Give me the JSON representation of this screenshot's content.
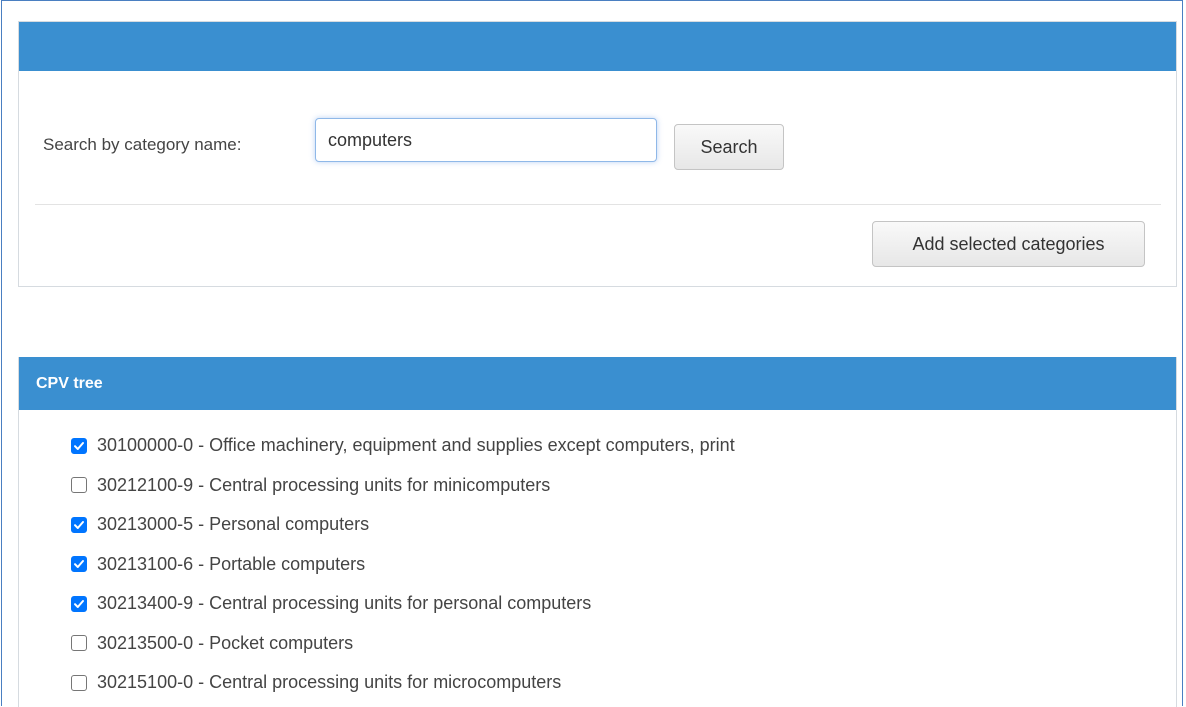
{
  "search_panel": {
    "header_title": "",
    "search_label": "Search by category name:",
    "search_value": "computers",
    "search_placeholder": "",
    "search_button_label": "Search",
    "add_button_label": "Add selected categories"
  },
  "tree": {
    "title": "CPV tree",
    "items": [
      {
        "label": "30100000-0 - Office machinery, equipment and supplies except computers, print",
        "checked": true
      },
      {
        "label": "30212100-9 - Central processing units for minicomputers",
        "checked": false
      },
      {
        "label": "30213000-5 - Personal computers",
        "checked": true
      },
      {
        "label": "30213100-6 - Portable computers",
        "checked": true
      },
      {
        "label": "30213400-9 - Central processing units for personal computers",
        "checked": true
      },
      {
        "label": "30213500-0 - Pocket computers",
        "checked": false
      },
      {
        "label": "30215100-0 - Central processing units for microcomputers",
        "checked": false
      }
    ]
  },
  "colors": {
    "header_bg": "#3a8fd0",
    "checkbox_checked": "#0075ff"
  }
}
